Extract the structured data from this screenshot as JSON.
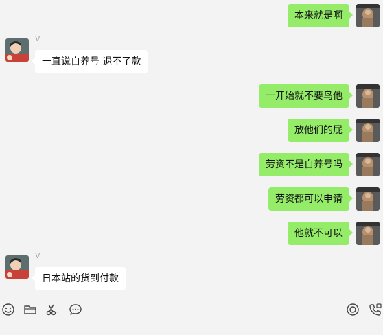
{
  "chat": {
    "messages": [
      {
        "side": "me",
        "text": "本来就是啊"
      },
      {
        "side": "other",
        "sender": "V",
        "text": "一直说自养号 退不了款"
      },
      {
        "side": "me",
        "text": "一开始就不要鸟他"
      },
      {
        "side": "me",
        "text": "放他们的屁"
      },
      {
        "side": "me",
        "text": "劳资不是自养号吗"
      },
      {
        "side": "me",
        "text": "劳资都可以申请"
      },
      {
        "side": "me",
        "text": "他就不可以"
      },
      {
        "side": "other",
        "sender": "V",
        "text": "日本站的货到付款"
      }
    ]
  },
  "toolbar": {
    "left_icons": [
      "emoji-icon",
      "folder-icon",
      "scissors-icon",
      "chat-bubble-icon"
    ],
    "right_icons": [
      "live-icon",
      "video-call-icon"
    ]
  },
  "colors": {
    "background": "#f3f3f3",
    "my_bubble": "#95ec69",
    "other_bubble": "#ffffff",
    "sender_name": "#a6a6a6"
  }
}
